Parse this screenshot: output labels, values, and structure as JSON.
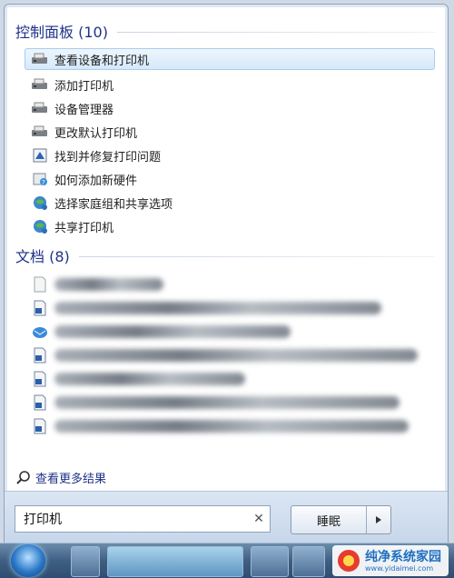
{
  "control_panel": {
    "title": "控制面板 (10)",
    "items": [
      {
        "label": "查看设备和打印机",
        "icon": "printer-icon",
        "selected": true
      },
      {
        "label": "添加打印机",
        "icon": "printer-icon"
      },
      {
        "label": "设备管理器",
        "icon": "printer-icon"
      },
      {
        "label": "更改默认打印机",
        "icon": "printer-icon"
      },
      {
        "label": "找到并修复打印问题",
        "icon": "troubleshoot-icon"
      },
      {
        "label": "如何添加新硬件",
        "icon": "help-icon"
      },
      {
        "label": "选择家庭组和共享选项",
        "icon": "homegroup-icon"
      },
      {
        "label": "共享打印机",
        "icon": "homegroup-icon"
      }
    ]
  },
  "documents": {
    "title": "文档 (8)",
    "item_count_shown": 7,
    "icon": "word-document-icon"
  },
  "see_more": {
    "label": "查看更多结果",
    "icon": "search-icon"
  },
  "search": {
    "value": "打印机",
    "clear_icon": "clear-icon"
  },
  "power": {
    "label": "睡眠",
    "arrow_icon": "chevron-right-icon"
  },
  "taskbar": {
    "start_icon": "windows-orb-icon"
  },
  "watermark": {
    "brand": "纯净系统家园",
    "url": "www.yidaimei.com"
  },
  "colors": {
    "section_title": "#1e3287",
    "selection": "#d6e9fa"
  }
}
